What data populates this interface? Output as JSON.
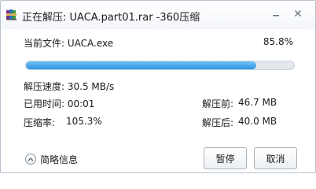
{
  "window": {
    "title": "正在解压: UACA.part01.rar -360压缩"
  },
  "file": {
    "label": "当前文件: UACA.exe",
    "percent_text": "85.8%",
    "progress": 0.858
  },
  "stats": {
    "speed": "解压速度: 30.5 MB/s",
    "elapsed": "已用时间: 00:01",
    "ratio_label": "压缩率:",
    "ratio_value": "105.3%",
    "before_label": "解压前:",
    "before_value": "46.7 MB",
    "after_label": "解压后:",
    "after_value": "40.0 MB"
  },
  "footer": {
    "detail_toggle": "简略信息",
    "pause": "暂停",
    "cancel": "取消"
  },
  "colors": {
    "progress_fill": "#2f96e2",
    "progress_track": "#e3e7ec"
  },
  "icons": {
    "app": "winrar-books-icon",
    "minimize": "minimize-icon",
    "close": "close-icon",
    "toggle": "chevron-up-circle-icon"
  }
}
